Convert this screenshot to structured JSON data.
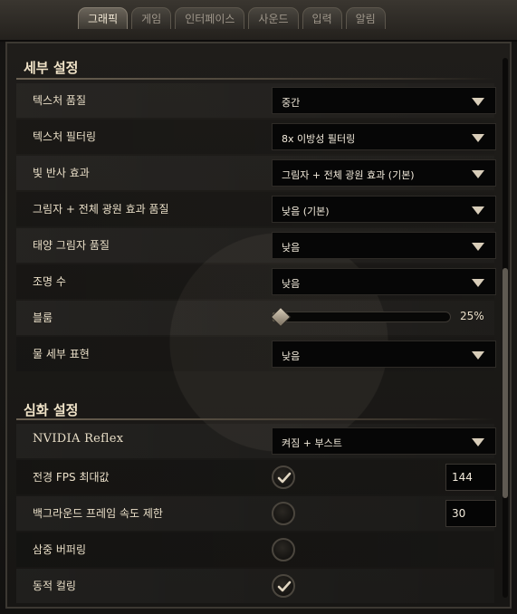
{
  "tabs": [
    "그래픽",
    "게임",
    "인터페이스",
    "사운드",
    "입력",
    "알림"
  ],
  "active_tab": "그래픽",
  "sections": {
    "detail": {
      "title": "세부 설정",
      "rows": [
        {
          "label": "텍스처 품질",
          "value": "중간"
        },
        {
          "label": "텍스처 필터링",
          "value": "8x 이방성 필터링"
        },
        {
          "label": "빛 반사 효과",
          "value": "그림자 + 전체 광원 효과 (기본)"
        },
        {
          "label": "그림자 + 전체 광원 효과 품질",
          "value": "낮음 (기본)"
        },
        {
          "label": "태양 그림자 품질",
          "value": "낮음"
        },
        {
          "label": "조명 수",
          "value": "낮음"
        }
      ],
      "bloom": {
        "label": "블룸",
        "value_text": "25%",
        "level": 0.25
      },
      "water": {
        "label": "물 세부 표현",
        "value": "낮음"
      }
    },
    "advanced": {
      "title": "심화 설정",
      "reflex": {
        "label": "NVIDIA Reflex",
        "value": "켜짐 + 부스트"
      },
      "fg_fps": {
        "label": "전경 FPS 최대값",
        "checked": true,
        "value": "144"
      },
      "bg_fps": {
        "label": "백그라운드 프레임 속도 제한",
        "checked": false,
        "value": "30"
      },
      "triple_buffer": {
        "label": "삼중 버퍼링",
        "checked": false
      },
      "dynamic_culling": {
        "label": "동적 컬링",
        "checked": true
      }
    }
  },
  "colors": {
    "accent": "#d8cdb9",
    "text": "#eadfc8",
    "dropdown_bg": "#060606"
  },
  "icons": {
    "dropdown": "chevron-down-icon",
    "check": "check-icon"
  }
}
